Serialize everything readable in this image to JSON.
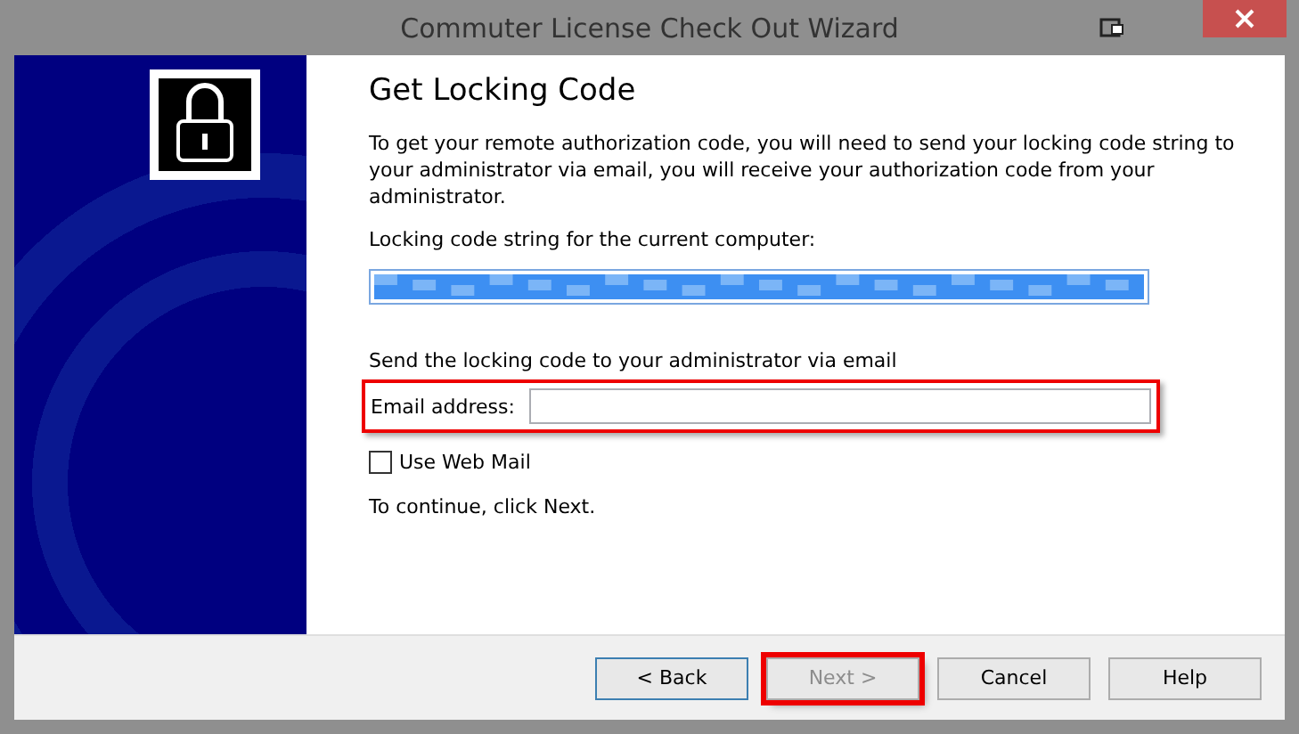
{
  "window": {
    "title": "Commuter License Check Out Wizard"
  },
  "heading": "Get Locking Code",
  "intro": "To get your remote authorization code, you will need to send your locking code string to your administrator via email, you will receive your authorization code from your administrator.",
  "locking_code": {
    "label": "Locking code string for the current computer:",
    "selected": true
  },
  "email_section": {
    "title": "Send the locking code to your administrator via email",
    "label": "Email address:",
    "highlighted": true
  },
  "web_mail": {
    "label": "Use Web Mail",
    "checked": false
  },
  "hint": "To continue, click Next.",
  "buttons": [
    {
      "label": "< Back",
      "disabled": false,
      "focused": true,
      "highlighted": false
    },
    {
      "label": "Next >",
      "disabled": true,
      "focused": false,
      "highlighted": true
    },
    {
      "label": "Cancel",
      "disabled": false,
      "focused": false,
      "highlighted": false
    },
    {
      "label": "Help",
      "disabled": false,
      "focused": false,
      "highlighted": false
    }
  ]
}
